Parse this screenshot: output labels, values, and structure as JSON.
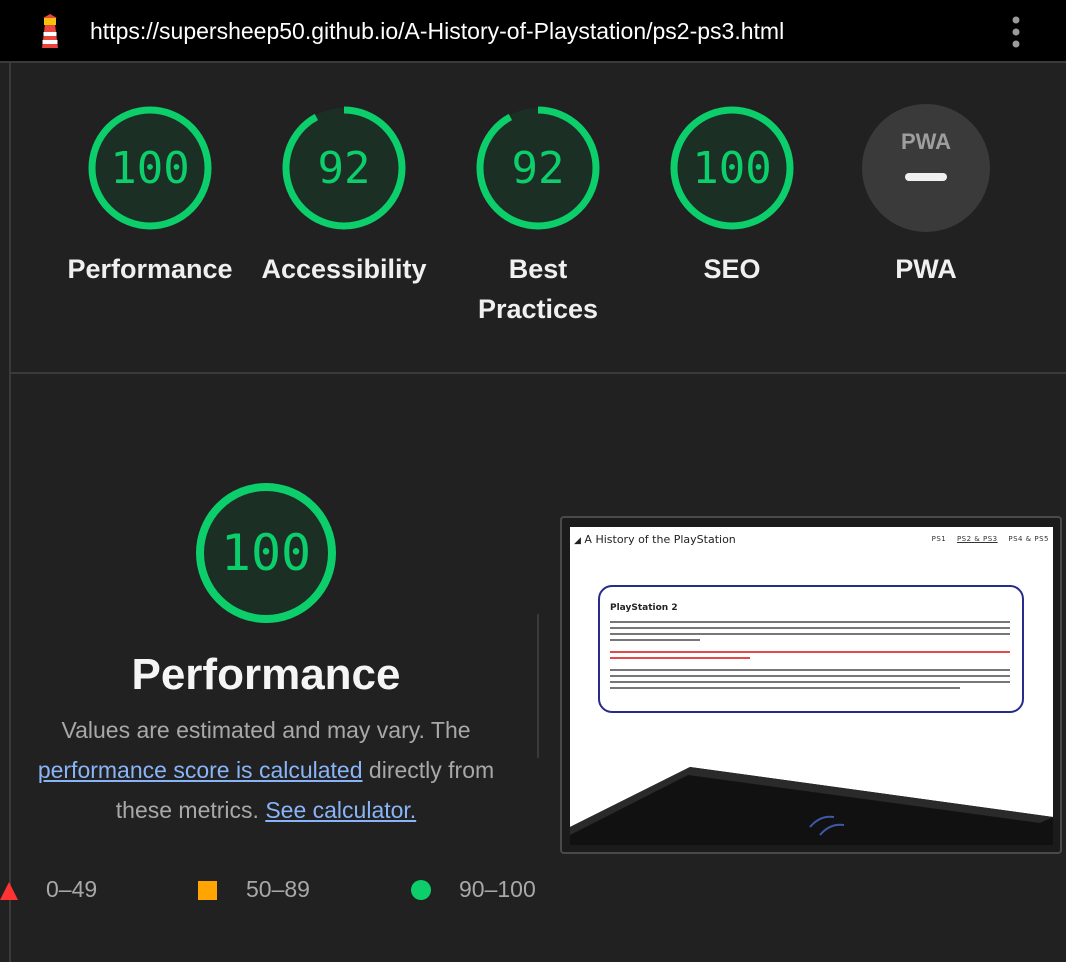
{
  "browser": {
    "url": "https://supersheep50.github.io/A-History-of-Playstation/ps2-ps3.html"
  },
  "gauges": [
    {
      "score": "100",
      "label_line1": "Performance",
      "label_line2": "",
      "value": 1.0
    },
    {
      "score": "92",
      "label_line1": "Accessibility",
      "label_line2": "",
      "value": 0.92
    },
    {
      "score": "92",
      "label_line1": "Best",
      "label_line2": "Practices",
      "value": 0.92
    },
    {
      "score": "100",
      "label_line1": "SEO",
      "label_line2": "",
      "value": 1.0
    },
    {
      "score": "PWA",
      "label_line1": "PWA",
      "label_line2": ""
    }
  ],
  "performance": {
    "score": "100",
    "title": "Performance",
    "desc_prefix": "Values are estimated and may vary. The",
    "desc_link": "performance score is calculated",
    "desc_mid": " directly from these metrics.",
    "calc_link": "See calculator."
  },
  "legend": [
    {
      "range": "0–49",
      "color": "#ff3333",
      "shape": "triangle"
    },
    {
      "range": "50–89",
      "color": "#ffa400",
      "shape": "square"
    },
    {
      "range": "90–100",
      "color": "#0cce6b",
      "shape": "circle"
    }
  ],
  "screenshot": {
    "site_title": "A History of the PlayStation",
    "nav": [
      "PS1",
      "PS2 & PS3",
      "PS4 & PS5"
    ],
    "card_heading": "PlayStation 2"
  },
  "colors": {
    "pass": "#0cce6b",
    "pass_bg": "#1c2f25",
    "neutral_bg": "#3a3a3a"
  }
}
